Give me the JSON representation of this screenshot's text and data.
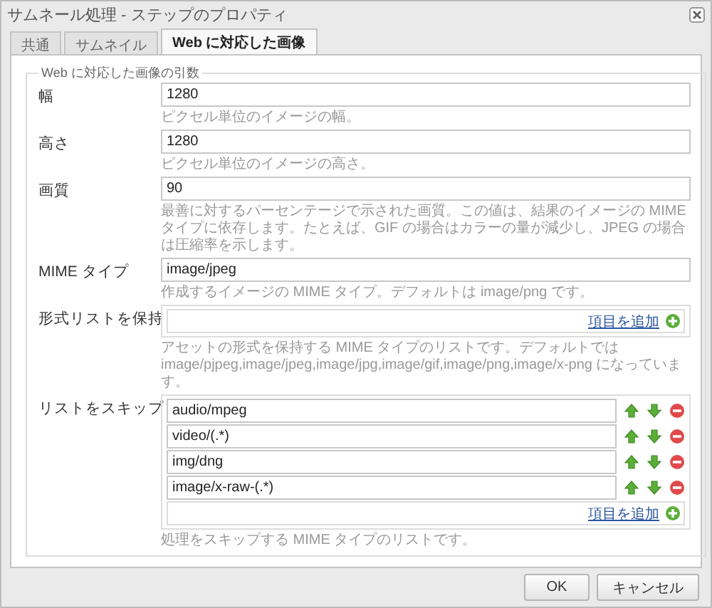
{
  "window": {
    "title": "サムネール処理 - ステップのプロパティ"
  },
  "tabs": [
    {
      "label": "共通",
      "selected": false
    },
    {
      "label": "サムネイル",
      "selected": false
    },
    {
      "label": "Web に対応した画像",
      "selected": true
    }
  ],
  "fieldset": {
    "legend": "Web に対応した画像の引数",
    "fields": [
      {
        "kind": "text",
        "label": "幅",
        "value": "1280",
        "help": "ピクセル単位のイメージの幅。"
      },
      {
        "kind": "text",
        "label": "高さ",
        "value": "1280",
        "help": "ピクセル単位のイメージの高さ。"
      },
      {
        "kind": "text",
        "label": "画質",
        "value": "90",
        "help": "最善に対するパーセンテージで示された画質。この値は、結果のイメージの MIME タイプに依存します。たとえば、GIF の場合はカラーの量が減少し、JPEG の場合は圧縮率を示します。"
      },
      {
        "kind": "text",
        "label": "MIME タイプ",
        "value": "image/jpeg",
        "help": "作成するイメージの MIME タイプ。デフォルトは image/png です。"
      },
      {
        "kind": "list",
        "label": "形式リストを保持",
        "add_link": "項目を追加",
        "help": "アセットの形式を保持する MIME タイプのリストです。デフォルトでは image/pjpeg,image/jpeg,image/jpg,image/gif,image/png,image/x-png になっています。"
      },
      {
        "kind": "list",
        "label": "リストをスキップ",
        "items": [
          "audio/mpeg",
          "video/(.*)",
          "img/dng",
          "image/x-raw-(.*)"
        ],
        "add_link": "項目を追加",
        "help": "処理をスキップする MIME タイプのリストです。"
      }
    ]
  },
  "buttons": [
    "OK",
    "キャンセル"
  ]
}
